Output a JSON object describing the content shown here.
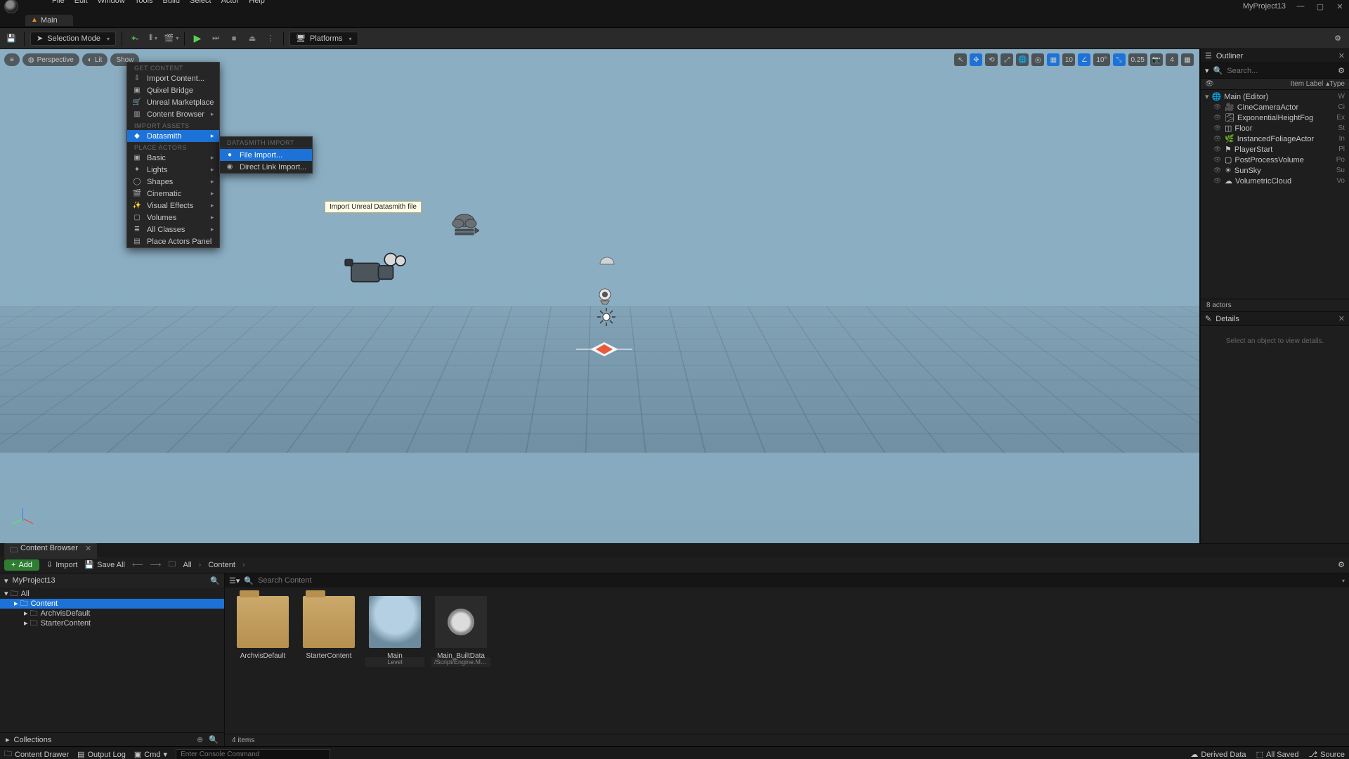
{
  "window": {
    "project_name": "MyProject13"
  },
  "menubar": [
    "File",
    "Edit",
    "Window",
    "Tools",
    "Build",
    "Select",
    "Actor",
    "Help"
  ],
  "tab": {
    "label": "Main"
  },
  "toolbar": {
    "mode_label": "Selection Mode",
    "platforms_label": "Platforms"
  },
  "viewport": {
    "pills": {
      "perspective": "Perspective",
      "lit": "Lit",
      "show": "Show"
    },
    "snap": {
      "angle": "10°",
      "scale": "0.25",
      "camera_speed": "4"
    }
  },
  "context_menu": {
    "headers": {
      "get_content": "GET CONTENT",
      "import_assets": "IMPORT ASSETS",
      "place_actors": "PLACE ACTORS"
    },
    "items": {
      "import_content": "Import Content...",
      "quixel": "Quixel Bridge",
      "marketplace": "Unreal Marketplace",
      "content_browser": "Content Browser",
      "datasmith": "Datasmith",
      "basic": "Basic",
      "lights": "Lights",
      "shapes": "Shapes",
      "cinematic": "Cinematic",
      "visual_effects": "Visual Effects",
      "volumes": "Volumes",
      "all_classes": "All Classes",
      "place_panel": "Place Actors Panel"
    },
    "sub": {
      "header": "DATASMITH IMPORT",
      "file_import": "File Import...",
      "direct_link": "Direct Link Import..."
    },
    "tooltip": "Import Unreal Datasmith file"
  },
  "outliner": {
    "title": "Outliner",
    "search_placeholder": "Search...",
    "col_label": "Item Label",
    "col_type": "Type",
    "root_label": "Main (Editor)",
    "actors": [
      {
        "label": "CineCameraActor",
        "type": "Ci",
        "kind": "camera"
      },
      {
        "label": "ExponentialHeightFog",
        "type": "Ex",
        "kind": "fog"
      },
      {
        "label": "Floor",
        "type": "St",
        "kind": "mesh"
      },
      {
        "label": "InstancedFoliageActor",
        "type": "In",
        "kind": "foliage"
      },
      {
        "label": "PlayerStart",
        "type": "Pl",
        "kind": "playerstart"
      },
      {
        "label": "PostProcessVolume",
        "type": "Po",
        "kind": "volume"
      },
      {
        "label": "SunSky",
        "type": "Su",
        "kind": "sun"
      },
      {
        "label": "VolumetricCloud",
        "type": "Vo",
        "kind": "cloud"
      }
    ],
    "footer": "8 actors"
  },
  "details": {
    "title": "Details",
    "placeholder": "Select an object to view details."
  },
  "content_browser": {
    "title": "Content Browser",
    "add": "Add",
    "import": "Import",
    "save_all": "Save All",
    "breadcrumb": [
      "All",
      "Content"
    ],
    "project": "MyProject13",
    "tree": [
      {
        "label": "All",
        "kind": "root",
        "sel": false,
        "indent": 0
      },
      {
        "label": "Content",
        "kind": "folder",
        "sel": true,
        "indent": 1
      },
      {
        "label": "ArchvisDefault",
        "kind": "folder",
        "sel": false,
        "indent": 2
      },
      {
        "label": "StarterContent",
        "kind": "folder",
        "sel": false,
        "indent": 2
      }
    ],
    "search_placeholder": "Search Content",
    "assets": [
      {
        "label": "ArchvisDefault",
        "thumb": "folder",
        "sub": ""
      },
      {
        "label": "StarterContent",
        "thumb": "folder",
        "sub": ""
      },
      {
        "label": "Main",
        "thumb": "level",
        "sub": "Level"
      },
      {
        "label": "Main_BuiltData",
        "thumb": "data",
        "sub": "/Script/Engine.MapBuil..."
      }
    ],
    "collections": "Collections",
    "item_count": "4 items"
  },
  "statusbar": {
    "content_drawer": "Content Drawer",
    "output_log": "Output Log",
    "cmd": "Cmd",
    "console_placeholder": "Enter Console Command",
    "derived": "Derived Data",
    "saved": "All Saved",
    "source": "Source"
  }
}
